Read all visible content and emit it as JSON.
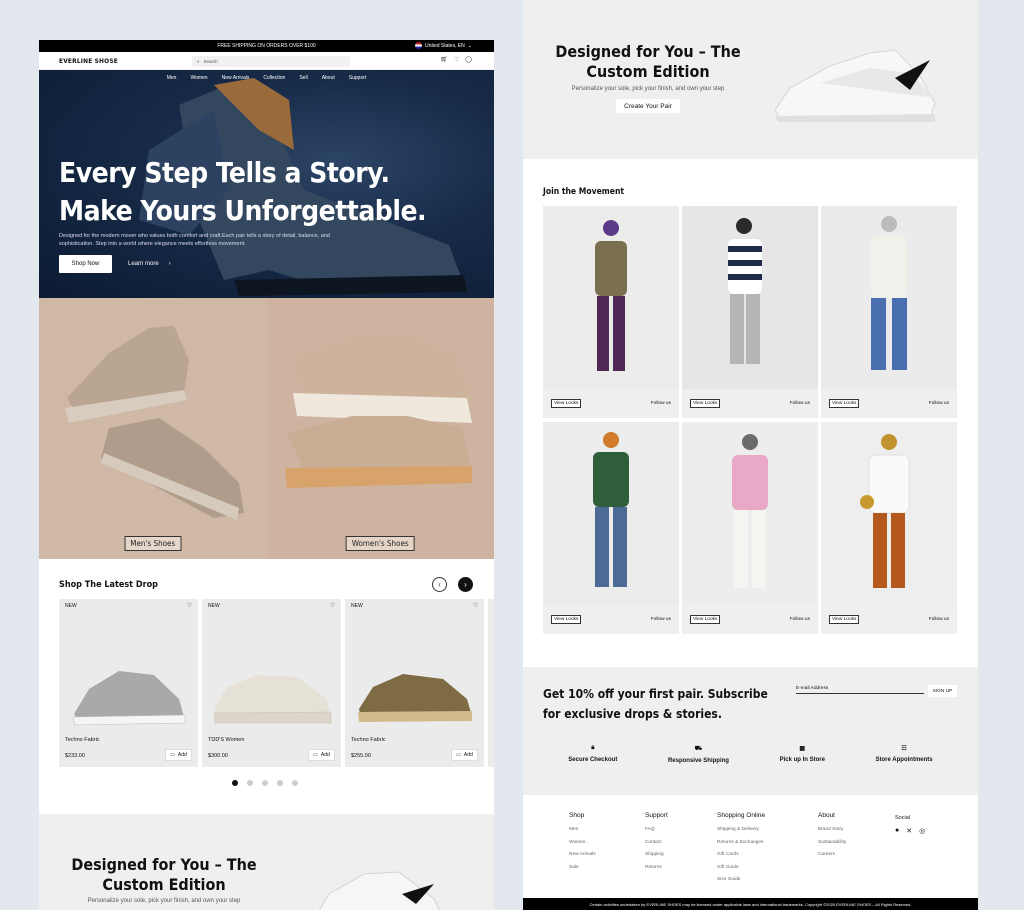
{
  "promo": {
    "text": "FREE SHIPPING ON ORDERS OVER $100",
    "region": "United States, EN"
  },
  "header": {
    "logo": "EVERLINE SHOSE",
    "search_placeholder": "Search"
  },
  "nav": [
    "Men",
    "Women",
    "New Arrivals",
    "Collection",
    "Sell",
    "About",
    "Support"
  ],
  "hero": {
    "title_line1": "Every Step Tells a Story.",
    "title_line2": "Make Yours Unforgettable.",
    "description": "Designed for the modern mover who values both comfort and craft.Each pair tells a story of detail, balance, and sophistication. Step into a world where elegance meets effortless movement.",
    "shop_button": "Shop Now",
    "learn_button": "Learn more"
  },
  "categories": [
    {
      "label": "Men's Shoes"
    },
    {
      "label": "Women's Shoes"
    }
  ],
  "latest": {
    "title": "Shop The Latest Drop",
    "products": [
      {
        "badge": "NEW",
        "name": "Techno Fabric",
        "price": "$233.00",
        "add": "Add"
      },
      {
        "badge": "NEW",
        "name": "TDD'S Women",
        "price": "$300.00",
        "add": "Add"
      },
      {
        "badge": "NEW",
        "name": "Techno Fabric",
        "price": "$255.00",
        "add": "Add"
      }
    ],
    "active_slide": 1,
    "slide_count": 5
  },
  "custom": {
    "title": "Designed for You – The Custom Edition",
    "subtitle": "Personalize your sole, pick your finish, and own your step",
    "button": "Create Your Pair"
  },
  "movement": {
    "title": "Join the Movement",
    "view_label": "View Looks",
    "follow_label": "Follow us"
  },
  "newsletter": {
    "title": "Get 10% off your first pair. Subscribe for exclusive drops & stories.",
    "email_placeholder": "E-mail Address",
    "signup": "SIGN UP"
  },
  "features": [
    "Secure Checkout",
    "Responsive Shipping",
    "Pick up In Store",
    "Store Appointments"
  ],
  "footer": {
    "shop": {
      "heading": "Shop",
      "items": [
        "Men",
        "Women",
        "New Arrivals",
        "Sale"
      ]
    },
    "support": {
      "heading": "Support",
      "items": [
        "FAQ",
        "Contact",
        "Shipping",
        "Returns"
      ]
    },
    "online": {
      "heading": "Shopping Online",
      "items": [
        "Shipping & Delivery",
        "Returns & Exchanges",
        "Gift Cards",
        "Gift Guide",
        "Size Guide"
      ]
    },
    "about": {
      "heading": "About",
      "items": [
        "Brand Story",
        "Sustainability",
        "Careers"
      ]
    },
    "social": "Social",
    "legal": "Certain activities undertaken by EVERLINE SHOES may be licensed under applicable laws and international trademarks. Copyright ©2025 EVERLINE SHOES – All Rights Reserved."
  }
}
